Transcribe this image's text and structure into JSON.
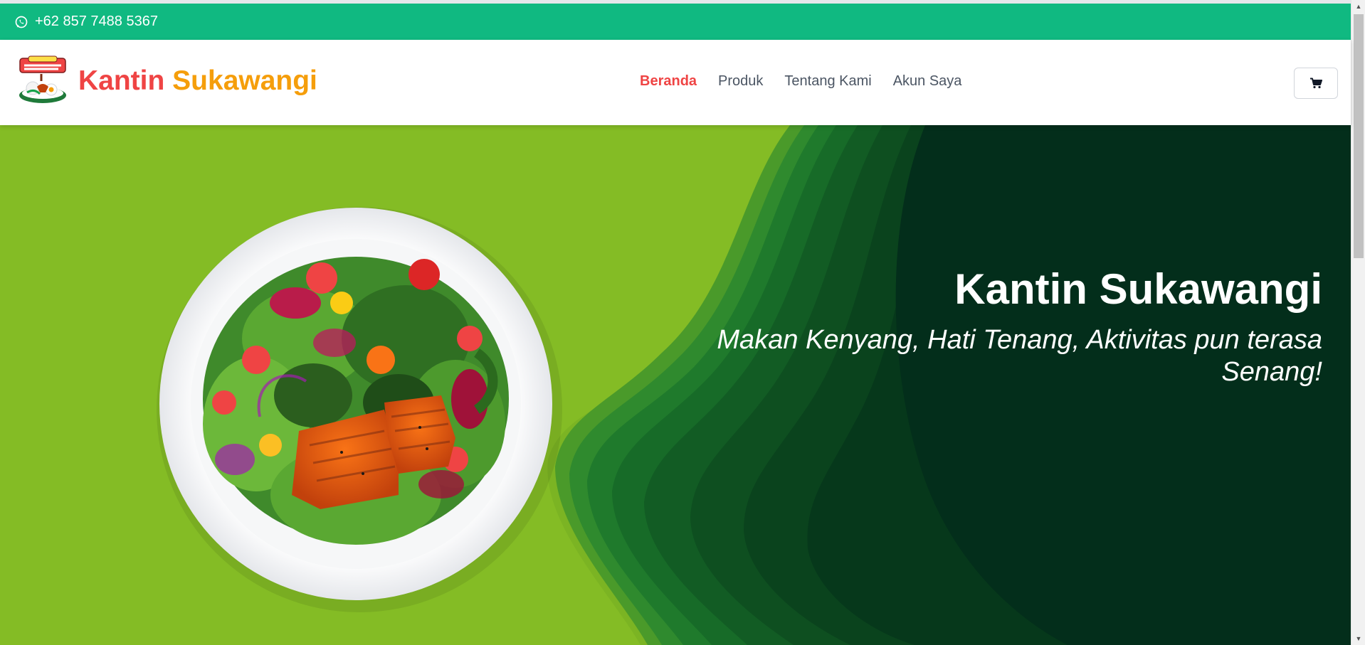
{
  "topbar": {
    "phone": "+62 857 7488 5367",
    "icon": "whatsapp-icon"
  },
  "brand": {
    "name_part1": "Kantin",
    "name_part2": "Sukawangi",
    "logo_text": "nasi lemak!"
  },
  "nav": {
    "items": [
      {
        "label": "Beranda",
        "active": true
      },
      {
        "label": "Produk",
        "active": false
      },
      {
        "label": "Tentang Kami",
        "active": false
      },
      {
        "label": "Akun Saya",
        "active": false
      }
    ],
    "cart_icon": "shopping-cart-icon"
  },
  "hero": {
    "title": "Kantin Sukawangi",
    "subtitle": "Makan Kenyang, Hati Tenang, Aktivitas pun terasa Senang!"
  },
  "colors": {
    "topbar": "#10b981",
    "brand_red": "#ef4444",
    "brand_orange": "#f59e0b",
    "hero_light_green": "#84bc25",
    "hero_dark_green": "#032e1b"
  }
}
